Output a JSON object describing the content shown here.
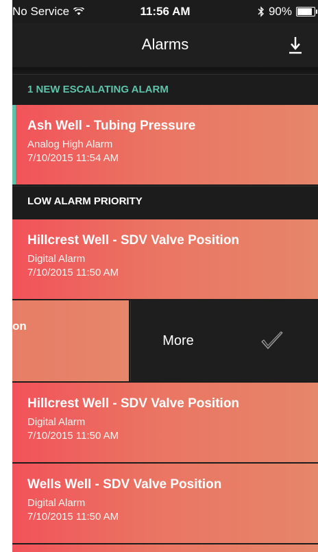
{
  "status_bar": {
    "carrier": "No Service",
    "time": "11:56 AM",
    "battery": "90%",
    "battery_level": 0.9
  },
  "nav": {
    "title": "Alarms",
    "download_icon": "download-icon"
  },
  "sections": {
    "escalating": "1 NEW ESCALATING ALARM",
    "low": "LOW ALARM PRIORITY"
  },
  "alarms": [
    {
      "title": "Ash Well - Tubing Pressure",
      "type": "Analog High Alarm",
      "time": "7/10/2015 11:54 AM"
    },
    {
      "title": "Hillcrest Well - SDV Valve Position",
      "type": "Digital Alarm",
      "time": "7/10/2015 11:50 AM"
    },
    {
      "title": "Hillcrest Well - SDV Valve Position",
      "type": "Digital Alarm",
      "time": "7/10/2015 11:50 AM"
    },
    {
      "title": "Wells Well - SDV Valve Position",
      "type": "Digital Alarm",
      "time": "7/10/2015 11:50 AM"
    }
  ],
  "swiped": {
    "partial_text": "on",
    "more_label": "More",
    "ack_icon": "checkmark-icon"
  },
  "colors": {
    "accent_teal": "#5fc3aa",
    "card_start": "#f2525a",
    "card_end": "#e6866a",
    "background": "#1c1c1c"
  }
}
